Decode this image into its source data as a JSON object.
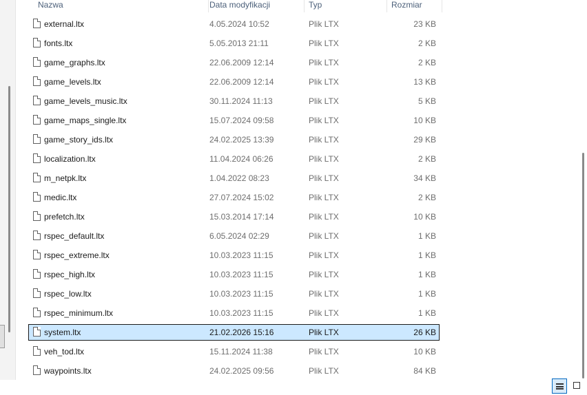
{
  "columns": {
    "name": "Nazwa",
    "date": "Data modyfikacji",
    "type": "Typ",
    "size": "Rozmiar"
  },
  "files": [
    {
      "name": "external.ltx",
      "date": "4.05.2024 10:52",
      "type": "Plik LTX",
      "size": "23 KB"
    },
    {
      "name": "fonts.ltx",
      "date": "5.05.2013 21:11",
      "type": "Plik LTX",
      "size": "2 KB"
    },
    {
      "name": "game_graphs.ltx",
      "date": "22.06.2009 12:14",
      "type": "Plik LTX",
      "size": "2 KB"
    },
    {
      "name": "game_levels.ltx",
      "date": "22.06.2009 12:14",
      "type": "Plik LTX",
      "size": "13 KB"
    },
    {
      "name": "game_levels_music.ltx",
      "date": "30.11.2024 11:13",
      "type": "Plik LTX",
      "size": "5 KB"
    },
    {
      "name": "game_maps_single.ltx",
      "date": "15.07.2024 09:58",
      "type": "Plik LTX",
      "size": "10 KB"
    },
    {
      "name": "game_story_ids.ltx",
      "date": "24.02.2025 13:39",
      "type": "Plik LTX",
      "size": "29 KB"
    },
    {
      "name": "localization.ltx",
      "date": "11.04.2024 06:26",
      "type": "Plik LTX",
      "size": "2 KB"
    },
    {
      "name": "m_netpk.ltx",
      "date": "1.04.2022 08:23",
      "type": "Plik LTX",
      "size": "34 KB"
    },
    {
      "name": "medic.ltx",
      "date": "27.07.2024 15:02",
      "type": "Plik LTX",
      "size": "2 KB"
    },
    {
      "name": "prefetch.ltx",
      "date": "15.03.2014 17:14",
      "type": "Plik LTX",
      "size": "10 KB"
    },
    {
      "name": "rspec_default.ltx",
      "date": "6.05.2024 02:29",
      "type": "Plik LTX",
      "size": "1 KB"
    },
    {
      "name": "rspec_extreme.ltx",
      "date": "10.03.2023 11:15",
      "type": "Plik LTX",
      "size": "1 KB"
    },
    {
      "name": "rspec_high.ltx",
      "date": "10.03.2023 11:15",
      "type": "Plik LTX",
      "size": "1 KB"
    },
    {
      "name": "rspec_low.ltx",
      "date": "10.03.2023 11:15",
      "type": "Plik LTX",
      "size": "1 KB"
    },
    {
      "name": "rspec_minimum.ltx",
      "date": "10.03.2023 11:15",
      "type": "Plik LTX",
      "size": "1 KB"
    },
    {
      "name": "system.ltx",
      "date": "21.02.2026 15:16",
      "type": "Plik LTX",
      "size": "26 KB",
      "selected": true
    },
    {
      "name": "veh_tod.ltx",
      "date": "15.11.2024 11:38",
      "type": "Plik LTX",
      "size": "10 KB"
    },
    {
      "name": "waypoints.ltx",
      "date": "24.02.2025 09:56",
      "type": "Plik LTX",
      "size": "84 KB"
    }
  ],
  "status_bar": {
    "view_details_icon": "details-view-icon",
    "view_tiles_icon": "large-icons-view-icon",
    "active_view": "details"
  },
  "colors": {
    "selection_bg": "#cce8ff",
    "header_text": "#4c607a",
    "accent": "#0067c0"
  }
}
